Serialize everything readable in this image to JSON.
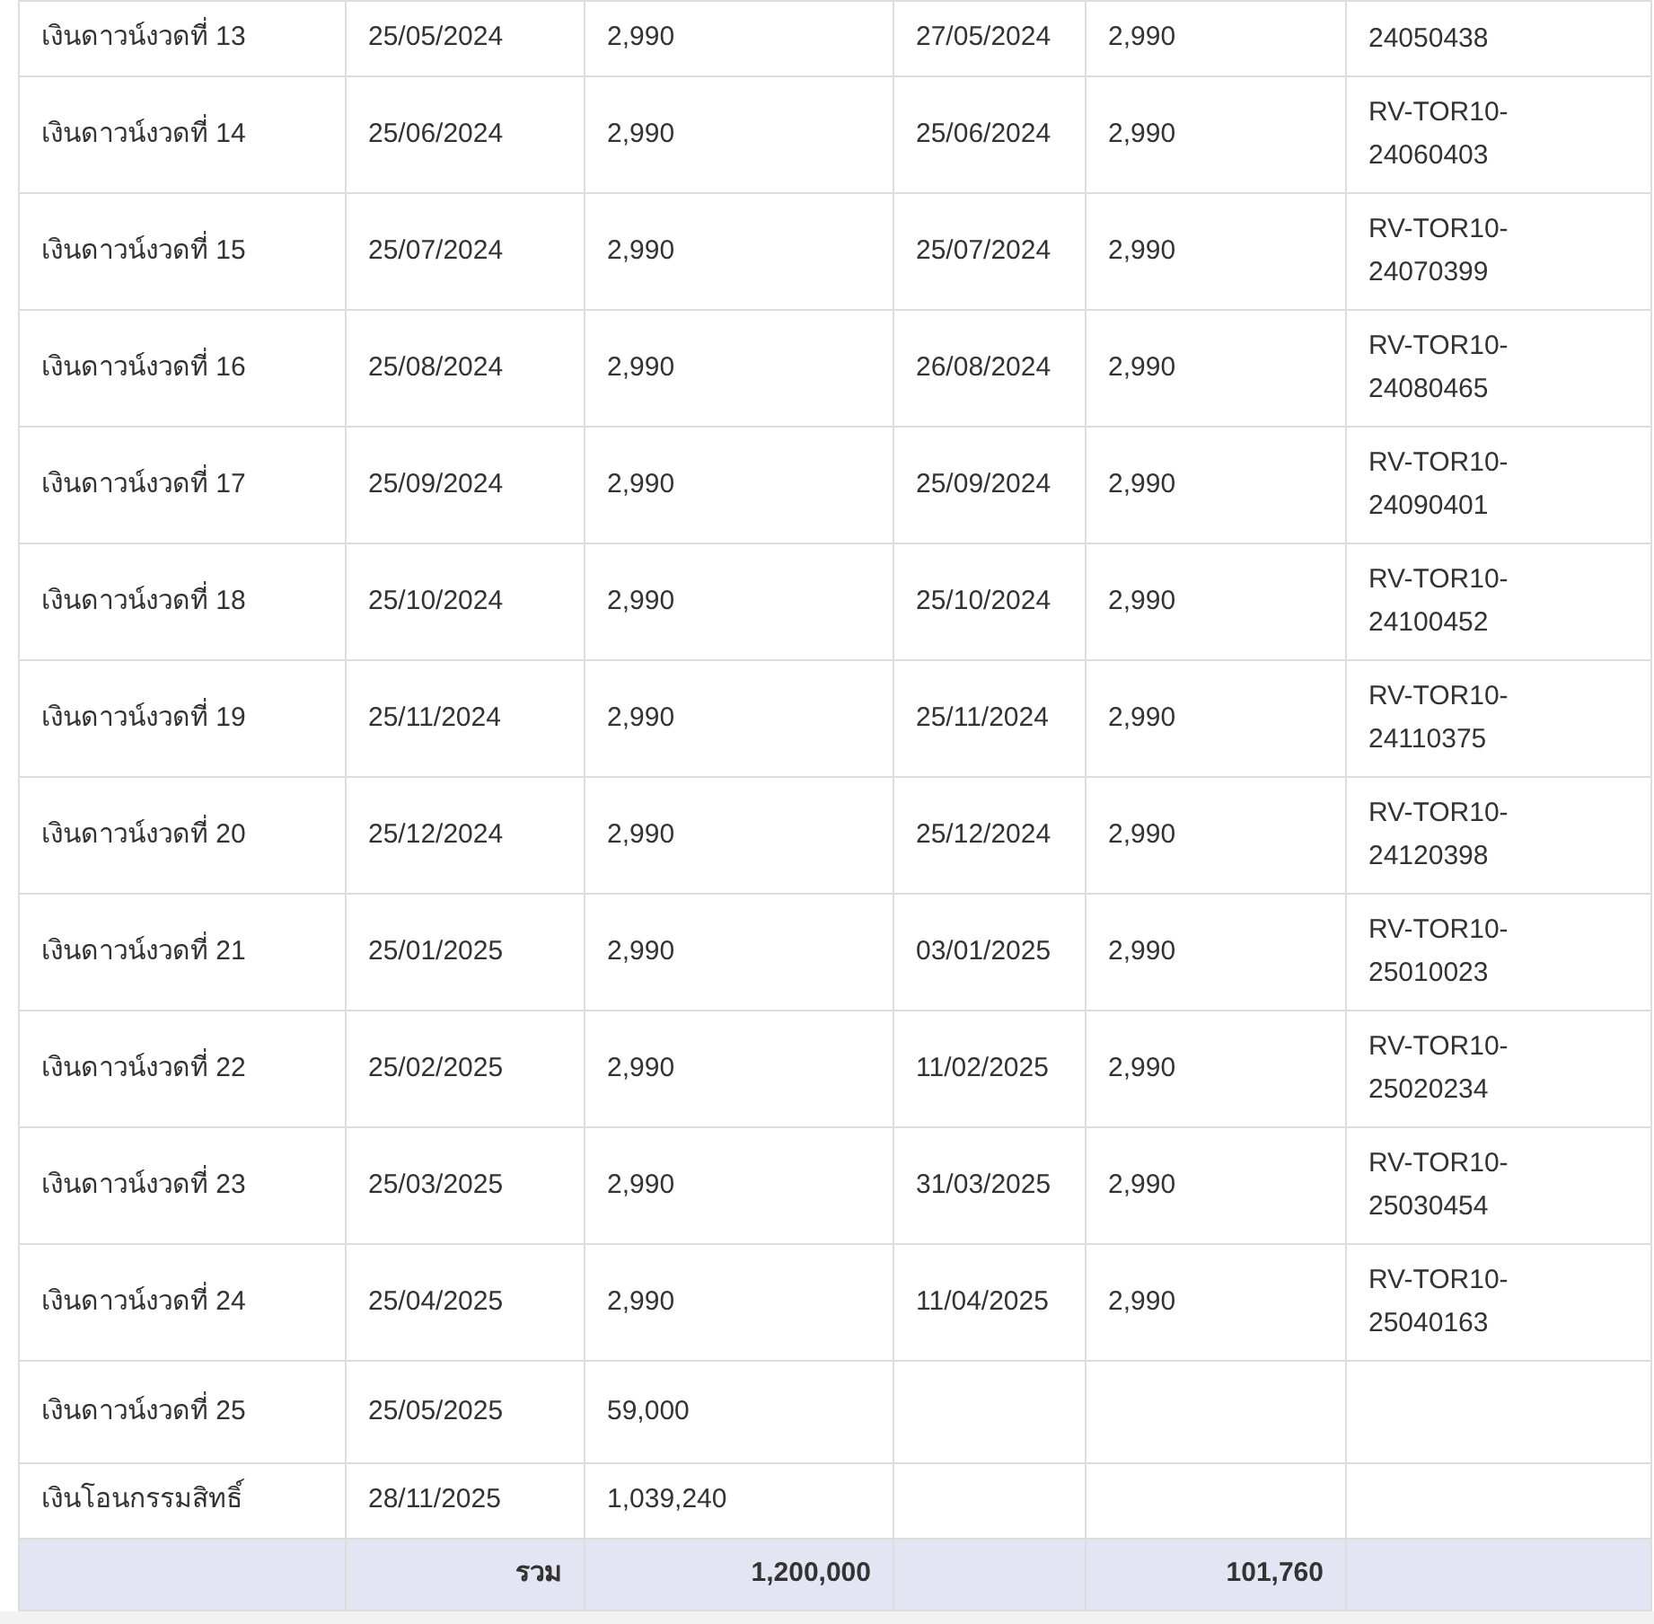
{
  "table": {
    "rows": [
      {
        "installment": "เงินดาวน์งวดที่ 13",
        "due_date": "25/05/2024",
        "amount": "2,990",
        "paid_date": "27/05/2024",
        "paid_amount": "2,990",
        "receipt": "24050438"
      },
      {
        "installment": "เงินดาวน์งวดที่ 14",
        "due_date": "25/06/2024",
        "amount": "2,990",
        "paid_date": "25/06/2024",
        "paid_amount": "2,990",
        "receipt": "RV-TOR10-24060403"
      },
      {
        "installment": "เงินดาวน์งวดที่ 15",
        "due_date": "25/07/2024",
        "amount": "2,990",
        "paid_date": "25/07/2024",
        "paid_amount": "2,990",
        "receipt": "RV-TOR10-24070399"
      },
      {
        "installment": "เงินดาวน์งวดที่ 16",
        "due_date": "25/08/2024",
        "amount": "2,990",
        "paid_date": "26/08/2024",
        "paid_amount": "2,990",
        "receipt": "RV-TOR10-24080465"
      },
      {
        "installment": "เงินดาวน์งวดที่ 17",
        "due_date": "25/09/2024",
        "amount": "2,990",
        "paid_date": "25/09/2024",
        "paid_amount": "2,990",
        "receipt": "RV-TOR10-24090401"
      },
      {
        "installment": "เงินดาวน์งวดที่ 18",
        "due_date": "25/10/2024",
        "amount": "2,990",
        "paid_date": "25/10/2024",
        "paid_amount": "2,990",
        "receipt": "RV-TOR10-24100452"
      },
      {
        "installment": "เงินดาวน์งวดที่ 19",
        "due_date": "25/11/2024",
        "amount": "2,990",
        "paid_date": "25/11/2024",
        "paid_amount": "2,990",
        "receipt": "RV-TOR10-24110375"
      },
      {
        "installment": "เงินดาวน์งวดที่ 20",
        "due_date": "25/12/2024",
        "amount": "2,990",
        "paid_date": "25/12/2024",
        "paid_amount": "2,990",
        "receipt": "RV-TOR10-24120398"
      },
      {
        "installment": "เงินดาวน์งวดที่ 21",
        "due_date": "25/01/2025",
        "amount": "2,990",
        "paid_date": "03/01/2025",
        "paid_amount": "2,990",
        "receipt": "RV-TOR10-25010023"
      },
      {
        "installment": "เงินดาวน์งวดที่ 22",
        "due_date": "25/02/2025",
        "amount": "2,990",
        "paid_date": "11/02/2025",
        "paid_amount": "2,990",
        "receipt": "RV-TOR10-25020234"
      },
      {
        "installment": "เงินดาวน์งวดที่ 23",
        "due_date": "25/03/2025",
        "amount": "2,990",
        "paid_date": "31/03/2025",
        "paid_amount": "2,990",
        "receipt": "RV-TOR10-25030454"
      },
      {
        "installment": "เงินดาวน์งวดที่ 24",
        "due_date": "25/04/2025",
        "amount": "2,990",
        "paid_date": "11/04/2025",
        "paid_amount": "2,990",
        "receipt": "RV-TOR10-25040163"
      },
      {
        "installment": "เงินดาวน์งวดที่ 25",
        "due_date": "25/05/2025",
        "amount": "59,000"
      },
      {
        "installment": "เงินโอนกรรมสิทธิ์",
        "due_date": "28/11/2025",
        "amount": "1,039,240"
      }
    ],
    "total": {
      "label": "รวม",
      "amount": "1,200,000",
      "paid_amount": "101,760"
    }
  }
}
